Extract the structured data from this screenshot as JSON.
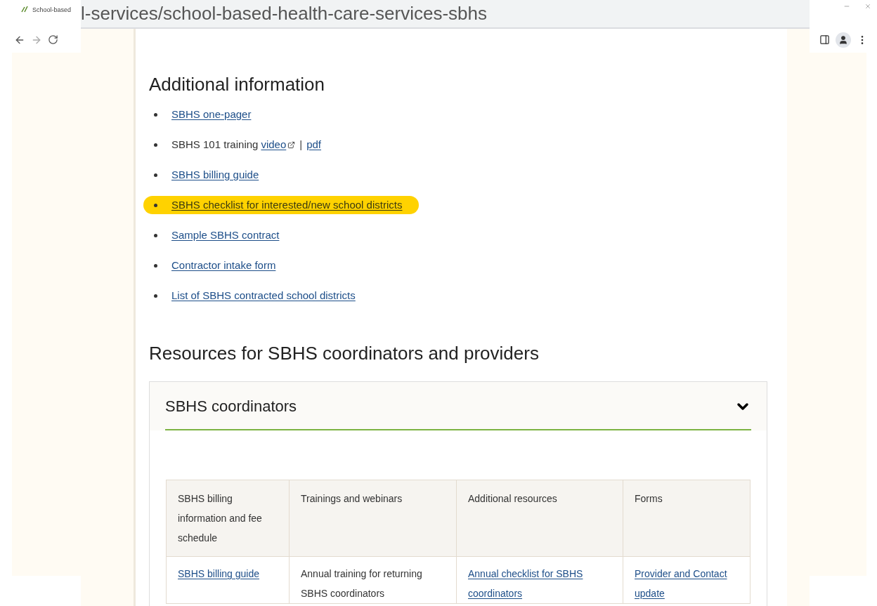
{
  "browser": {
    "tab_title": "School-based",
    "url": "l-services/school-based-health-care-services-sbhs"
  },
  "additional": {
    "heading": "Additional information",
    "items": [
      {
        "highlighted": false,
        "segments": [
          {
            "kind": "link",
            "text": "SBHS one-pager"
          }
        ]
      },
      {
        "highlighted": false,
        "segments": [
          {
            "kind": "text",
            "text": "SBHS 101 training"
          },
          {
            "kind": "external_link",
            "text": "video"
          },
          {
            "kind": "separator",
            "text": "|"
          },
          {
            "kind": "link",
            "text": "pdf"
          }
        ]
      },
      {
        "highlighted": false,
        "segments": [
          {
            "kind": "link",
            "text": "SBHS billing guide"
          }
        ]
      },
      {
        "highlighted": true,
        "segments": [
          {
            "kind": "link",
            "text": "SBHS checklist for interested/new school districts"
          }
        ]
      },
      {
        "highlighted": false,
        "segments": [
          {
            "kind": "link",
            "text": "Sample SBHS contract"
          }
        ]
      },
      {
        "highlighted": false,
        "segments": [
          {
            "kind": "link",
            "text": "Contractor intake form"
          }
        ]
      },
      {
        "highlighted": false,
        "segments": [
          {
            "kind": "link",
            "text": "List of SBHS contracted school districts"
          }
        ]
      }
    ]
  },
  "resources": {
    "heading": "Resources for SBHS coordinators and providers",
    "accordion": {
      "title": "SBHS coordinators",
      "expanded": true,
      "table": {
        "columns": [
          "SBHS billing information and fee schedule",
          "Trainings and webinars",
          "Additional resources",
          "Forms"
        ],
        "rows": [
          [
            {
              "text": "SBHS billing guide",
              "link": true
            },
            {
              "text": "Annual training for returning SBHS coordinators",
              "link": false
            },
            {
              "text": "Annual checklist for SBHS coordinators",
              "link": true
            },
            {
              "text": "Provider and Contact update",
              "link": true
            }
          ]
        ]
      }
    }
  }
}
